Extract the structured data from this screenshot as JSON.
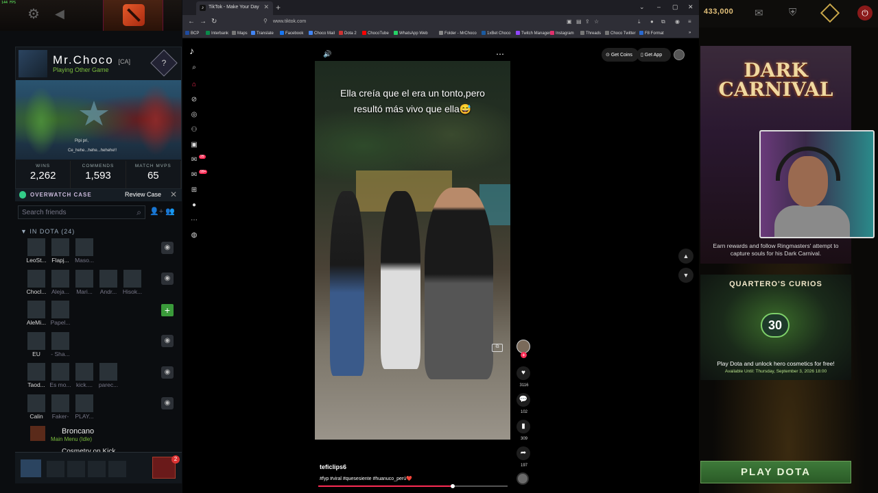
{
  "fps": "144 FPS",
  "dota_left": {
    "profile": {
      "name": "Mr.Choco",
      "tag": "[CA]",
      "status": "Playing Other Game",
      "rank_symbol": "?",
      "showcase_line1": "Pipi pri,",
      "showcase_line2": "Ce_hehe...hehe...hehehe!!",
      "stats": [
        {
          "label": "WINS",
          "value": "2,262"
        },
        {
          "label": "COMMENDS",
          "value": "1,593"
        },
        {
          "label": "MATCH MVPS",
          "value": "65"
        }
      ]
    },
    "overwatch": {
      "title": "OVERWATCH CASE",
      "review": "Review Case"
    },
    "friends_search_placeholder": "Search friends",
    "in_dota_header": "IN DOTA (24)",
    "friends": [
      {
        "name": "LeoSt...",
        "dim": false
      },
      {
        "name": "Flapj...",
        "dim": false
      },
      {
        "name": "Maso...",
        "dim": true
      },
      {
        "name": "Chocl...",
        "dim": false
      },
      {
        "name": "Aleja...",
        "dim": true
      },
      {
        "name": "Mari...",
        "dim": true
      },
      {
        "name": "Andr...",
        "dim": true
      },
      {
        "name": "Hisok...",
        "dim": true
      },
      {
        "name": "AleMi...",
        "dim": false
      },
      {
        "name": "Papel...",
        "dim": true
      },
      {
        "name": "EU",
        "dim": false
      },
      {
        "name": "- Sha...",
        "dim": true
      },
      {
        "name": "Taod...",
        "dim": false
      },
      {
        "name": "Es mo...",
        "dim": true
      },
      {
        "name": "kick....",
        "dim": true
      },
      {
        "name": "parec...",
        "dim": true
      },
      {
        "name": "Calin",
        "dim": false
      },
      {
        "name": "Faker-",
        "dim": true
      },
      {
        "name": "PLAY...",
        "dim": true
      }
    ],
    "broncano": {
      "name": "Broncano",
      "status": "Main Menu (Idle)"
    },
    "cosmetic": "Cosmetry on Kick",
    "invite_badge": "2"
  },
  "browser": {
    "tab_title": "TikTok - Make Your Day",
    "url": "www.tiktok.com",
    "bookmarks": [
      {
        "label": "BCP",
        "color": "#1e4ba0"
      },
      {
        "label": "Interbank",
        "color": "#0a8a4a"
      },
      {
        "label": "Maps",
        "color": "#777"
      },
      {
        "label": "Translate",
        "color": "#4285f4"
      },
      {
        "label": "Facebook",
        "color": "#1877f2"
      },
      {
        "label": "Choco Mail",
        "color": "#4285f4"
      },
      {
        "label": "Dota 2",
        "color": "#c33"
      },
      {
        "label": "ChocoTube",
        "color": "#f00"
      },
      {
        "label": "WhatsApp Web",
        "color": "#25d366"
      },
      {
        "label": "Folder - MrChoco",
        "color": "#888"
      },
      {
        "label": "1xBet Choco",
        "color": "#1a5aa0"
      },
      {
        "label": "Twitch Manager",
        "color": "#9146ff"
      },
      {
        "label": "Instagram",
        "color": "#e1306c"
      },
      {
        "label": "Threads",
        "color": "#777"
      },
      {
        "label": "Choco Twitter",
        "color": "#777"
      },
      {
        "label": "F8 Format",
        "color": "#2a6ad0"
      }
    ],
    "tiktok": {
      "get_coins": "Get Coins",
      "get_app": "Get App",
      "caption": "Ella creía que el era un tonto,pero resultó más vivo que ella😅",
      "author": "teficlips6",
      "tags": "#fyp #viral #quesesiente #huanuco_perú❤️",
      "progress": 0.71,
      "counts": {
        "likes": "3116",
        "comments": "102",
        "saves": "309",
        "shares": "197"
      },
      "badges": {
        "inbox": "25",
        "activity": "99+"
      }
    }
  },
  "dota_right": {
    "gold": "433,000",
    "carnival_title_1": "DARK",
    "carnival_title_2": "CARNIVAL",
    "carnival_desc": "Earn rewards and follow Ringmasters' attempt to capture souls for his Dark Carnival.",
    "curios_title": "QUARTERO'S CURIOS",
    "curios_number": "30",
    "curios_desc": "Play Dota and unlock hero cosmetics for free!",
    "curios_until": "Available Until:  Thursday, September 3, 2026 18:00",
    "play": "PLAY DOTA"
  }
}
